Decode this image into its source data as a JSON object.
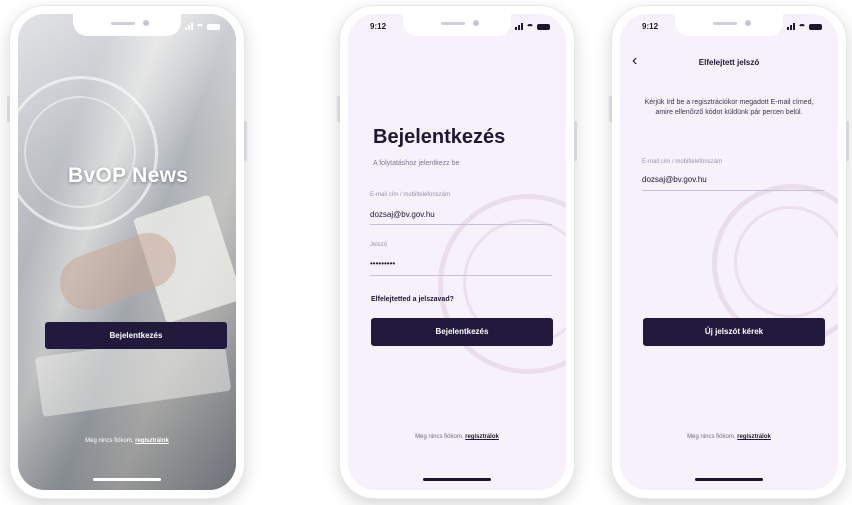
{
  "status_bar": {
    "time": "9:12"
  },
  "splash": {
    "brand": "BvOP News",
    "login_button": "Bejelentkezés",
    "register_prompt": "Még nincs fiókom,",
    "register_link": "regisztrálok"
  },
  "login": {
    "title": "Bejelentkezés",
    "subtitle": "A folytatáshoz jelentkezz be",
    "email_label": "E-mail cím / mobiltelefonszám",
    "email_value": "dozsaj@bv.gov.hu",
    "password_label": "Jelszó",
    "password_value": "•••••••••",
    "forgot_link": "Elfelejtetted a jelszavad?",
    "submit_button": "Bejelentkezés",
    "register_prompt": "Még nincs fiókom,",
    "register_link": "regisztrálok"
  },
  "forgot": {
    "back_icon": "chevron-left-icon",
    "title": "Elfelejtett jelszó",
    "info": "Kérjük írd be a regisztrációkor megadott E-mail címed, amire ellenőrző kódot küldünk pár percen belül.",
    "email_label": "E-mail cím / mobiltelefonszám",
    "email_value": "dozsaj@bv.gov.hu",
    "submit_button": "Új jelszót kérek",
    "register_prompt": "Még nincs fiókom,",
    "register_link": "regisztrálok"
  },
  "colors": {
    "primary": "#211a3d",
    "screen_bg": "#f7f1fb",
    "text": "#1e1838"
  }
}
